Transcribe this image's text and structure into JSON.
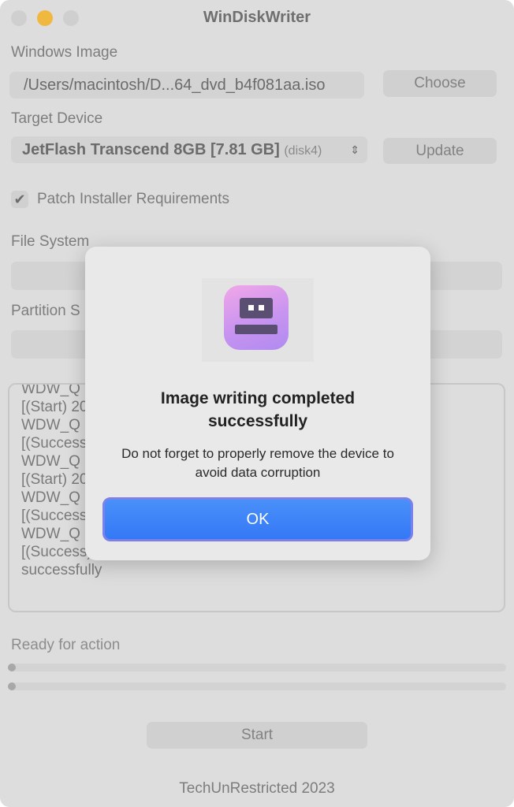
{
  "app": {
    "title": "WinDiskWriter"
  },
  "colors": {
    "accent": "#3478f6",
    "dimmed_bg": "#dddddd"
  },
  "form": {
    "windows_image_label": "Windows Image",
    "windows_image_path": "/Users/macintosh/D...64_dvd_b4f081aa.iso",
    "choose_button": "Choose",
    "target_device_label": "Target Device",
    "target_device_value": "JetFlash Transcend 8GB [7.81 GB]",
    "target_device_id": "(disk4)",
    "update_button": "Update",
    "patch_label": "Patch Installer Requirements",
    "patch_checked": true,
    "file_system_label": "File System",
    "partition_label": "Partition S"
  },
  "log": {
    "lines": [
      "WDW_Q",
      "[(Start) 20",
      "WDW_Q",
      "[(Success",
      "WDW_Q",
      "[(Start) 20",
      "WDW_Q",
      "[(Success",
      "WDW_Q",
      "[(Success)",
      "successfully"
    ]
  },
  "status": {
    "text": "Ready for action"
  },
  "start_button": "Start",
  "footer": "TechUnRestricted 2023",
  "dialog": {
    "icon": "app-icon",
    "title": "Image writing completed successfully",
    "message": "Do not forget to properly remove the device to avoid data corruption",
    "ok_button": "OK"
  }
}
